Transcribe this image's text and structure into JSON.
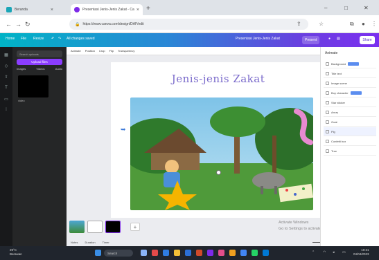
{
  "browser": {
    "tabs": [
      {
        "label": "Beranda",
        "active": false
      },
      {
        "label": "Presentasi Jenis-Jenis Zakat - Canva",
        "active": true
      }
    ],
    "url": "https://www.canva.com/design/DAF/edit",
    "new_tab": "+",
    "window_controls": [
      "–",
      "□",
      "✕"
    ]
  },
  "canva_bar": {
    "home": "Home",
    "file": "File",
    "resize": "Resize",
    "saved_status": "All changes saved",
    "doc_title": "Presentasi Jenis-Jenis Zakat",
    "present": "Present",
    "share": "Share"
  },
  "left_panel": {
    "search_placeholder": "Search uploads",
    "upload_button": "Upload files",
    "tabs": [
      "Images",
      "Videos",
      "Audio"
    ],
    "thumb_caption": "video"
  },
  "editor": {
    "toolbar": [
      "Animate",
      "Position",
      "Crop",
      "Flip",
      "Transparency"
    ],
    "slide_title": "Jenis-jenis Zakat",
    "add_page": "+",
    "activation_lines": [
      "Activate Windows",
      "Go to Settings to activate Windows."
    ],
    "bottom": [
      "Notes",
      "Duration",
      "Timer"
    ]
  },
  "right_panel": {
    "heading": "Animate",
    "items": [
      "Background",
      "Title text",
      "Image scene",
      "Boy character",
      "Star sticker",
      "Arrow",
      "Goat",
      "Pig",
      "Confetti box",
      "Tree"
    ]
  },
  "taskbar": {
    "weather_temp": "29°C",
    "weather_desc": "Berawan",
    "search": "Search",
    "time": "10:21",
    "date": "04/04/2023"
  },
  "colors": {
    "canva_gradient_start": "#00b3c6",
    "canva_gradient_end": "#7b2ff0",
    "title_purple": "#7a6acb",
    "upload_purple": "#8b3dff"
  }
}
